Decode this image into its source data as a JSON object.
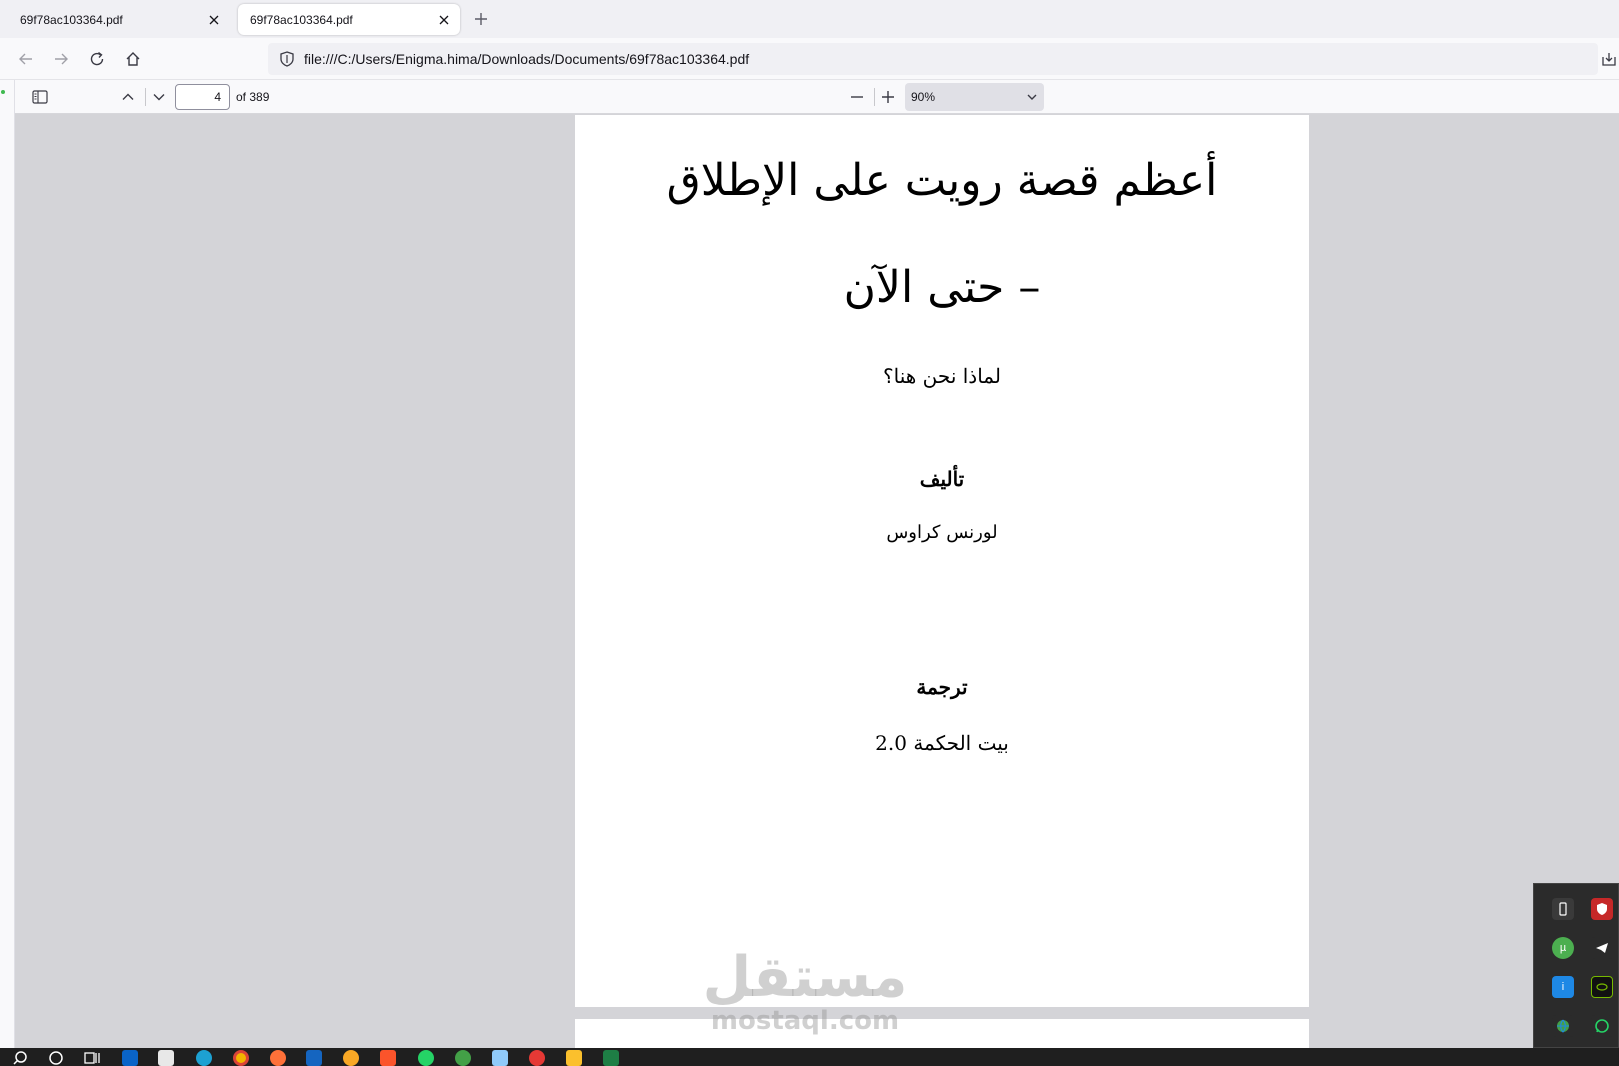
{
  "browser": {
    "tabs": [
      {
        "label": "69f78ac103364.pdf",
        "active": false
      },
      {
        "label": "69f78ac103364.pdf",
        "active": true
      }
    ],
    "url": "file:///C:/Users/Enigma.hima/Downloads/Documents/69f78ac103364.pdf"
  },
  "pdf_toolbar": {
    "current_page": "4",
    "page_count": "of 389",
    "zoom": "90%"
  },
  "document": {
    "title_line1": "أعظم قصة رويت على الإطلاق",
    "title_line2": "– حتى الآن",
    "subtitle": "لماذا نحن هنا؟",
    "author_heading": "تأليف",
    "author": "لورنس كراوس",
    "translation_heading": "ترجمة",
    "translator": "بيت الحكمة 2.0"
  },
  "watermark": {
    "arabic": "مستقل",
    "latin": "mostaql.com"
  },
  "icons": {
    "tray": [
      "usb-drive-icon",
      "antivirus-shield-icon",
      "utorrent-icon",
      "telegram-icon",
      "info-icon",
      "nvidia-icon",
      "network-globe-icon",
      "whatsapp-icon"
    ],
    "taskbar": [
      "search-icon",
      "cortana-icon",
      "task-view-icon",
      "outlook-icon",
      "store-icon",
      "edge-icon",
      "chrome-icon",
      "firefox-icon",
      "app-3-icon",
      "vpn-icon",
      "brave-icon",
      "whatsapp-icon",
      "network-icon",
      "file-app-icon",
      "camera-app-icon",
      "file-explorer-icon",
      "excel-icon"
    ]
  },
  "colors": {
    "accent_green": "#3fb950",
    "viewer_bg": "#d4d4d8",
    "toolbar_bg": "#f9f9fb"
  }
}
